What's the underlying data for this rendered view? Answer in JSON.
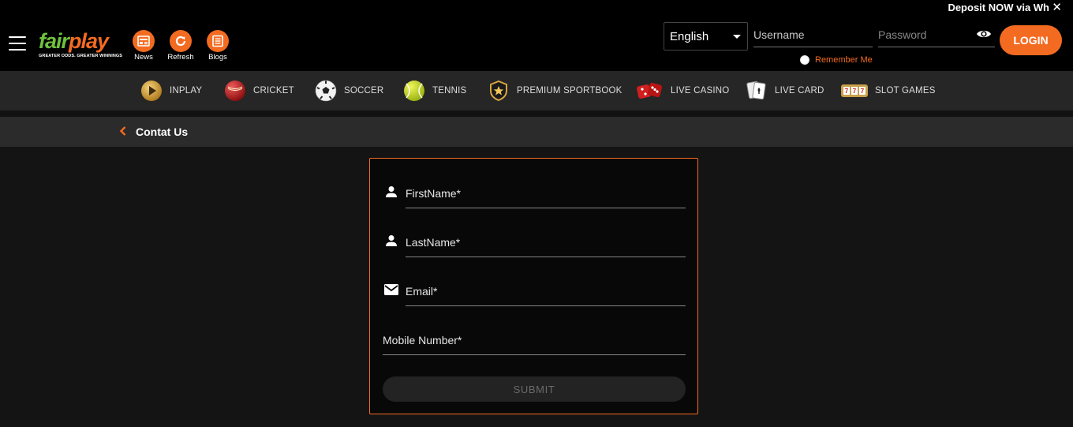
{
  "promo": {
    "text": "Deposit NOW via Wh",
    "close": "✕"
  },
  "brand": {
    "name_part1": "fair",
    "name_part2": "play",
    "tagline": "GREATER ODDS. GREATER WINNINGS"
  },
  "header_icons": [
    {
      "label": "News",
      "icon": "news-icon"
    },
    {
      "label": "Refresh",
      "icon": "refresh-icon"
    },
    {
      "label": "Blogs",
      "icon": "blogs-icon"
    }
  ],
  "language": {
    "selected": "English"
  },
  "login": {
    "username_placeholder": "Username",
    "password_placeholder": "Password",
    "remember_label": "Remember Me",
    "button_label": "LOGIN"
  },
  "nav": [
    {
      "label": "INPLAY",
      "icon": "play-icon"
    },
    {
      "label": "CRICKET",
      "icon": "cricket-ball-icon"
    },
    {
      "label": "SOCCER",
      "icon": "soccer-ball-icon"
    },
    {
      "label": "TENNIS",
      "icon": "tennis-ball-icon"
    },
    {
      "label": "PREMIUM SPORTBOOK",
      "icon": "premium-badge-icon"
    },
    {
      "label": "LIVE CASINO",
      "icon": "dice-icon"
    },
    {
      "label": "LIVE CARD",
      "icon": "cards-icon"
    },
    {
      "label": "SLOT GAMES",
      "icon": "slot-machine-icon"
    }
  ],
  "breadcrumb": {
    "title": "Contat Us"
  },
  "form": {
    "first_name_placeholder": "FirstName*",
    "last_name_placeholder": "LastName*",
    "email_placeholder": "Email*",
    "mobile_placeholder": "Mobile Number*",
    "submit_label": "SUBMIT"
  },
  "colors": {
    "accent": "#f36b21",
    "brand_green": "#6fc13d",
    "nav_bg": "#262626",
    "header_bg": "#000000"
  }
}
